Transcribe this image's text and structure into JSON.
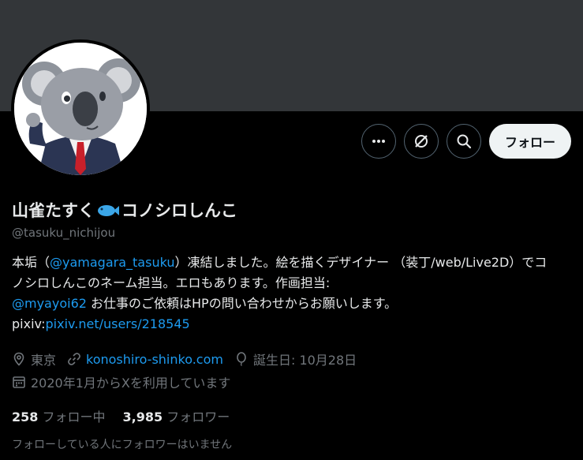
{
  "profile": {
    "name_part1": "山雀たすく",
    "emoji_icon": "fish-icon",
    "name_part2": "コノシロしんこ",
    "handle": "@tasuku_nichijou"
  },
  "actions": {
    "more_icon": "more-horizontal-icon",
    "grok_icon": "grok-icon",
    "search_icon": "search-icon",
    "follow_label": "フォロー"
  },
  "bio": {
    "text1": "本垢（",
    "mention1": "@yamagara_tasuku",
    "text2": "）凍結しました。絵を描くデザイナー （装丁/web/Live2D）でコノシロしんこのネーム担当。エロもあります。作画担当:",
    "mention2": "@myayoi62",
    "text3": " お仕事のご依頼はHPの問い合わせからお願いします。",
    "text4": "pixiv:",
    "link": "pixiv.net/users/218545"
  },
  "meta": {
    "location": "東京",
    "website": "konoshiro-shinko.com",
    "birthday": "誕生日: 10月28日",
    "joined": "2020年1月からXを利用しています"
  },
  "stats": {
    "following_count": "258",
    "following_label": "フォロー中",
    "followers_count": "3,985",
    "followers_label": "フォロワー"
  },
  "note": "フォローしている人にフォロワーはいません",
  "colors": {
    "accent": "#1d9bf0",
    "muted": "#71767b",
    "text": "#e7e9ea",
    "banner": "#333639"
  }
}
